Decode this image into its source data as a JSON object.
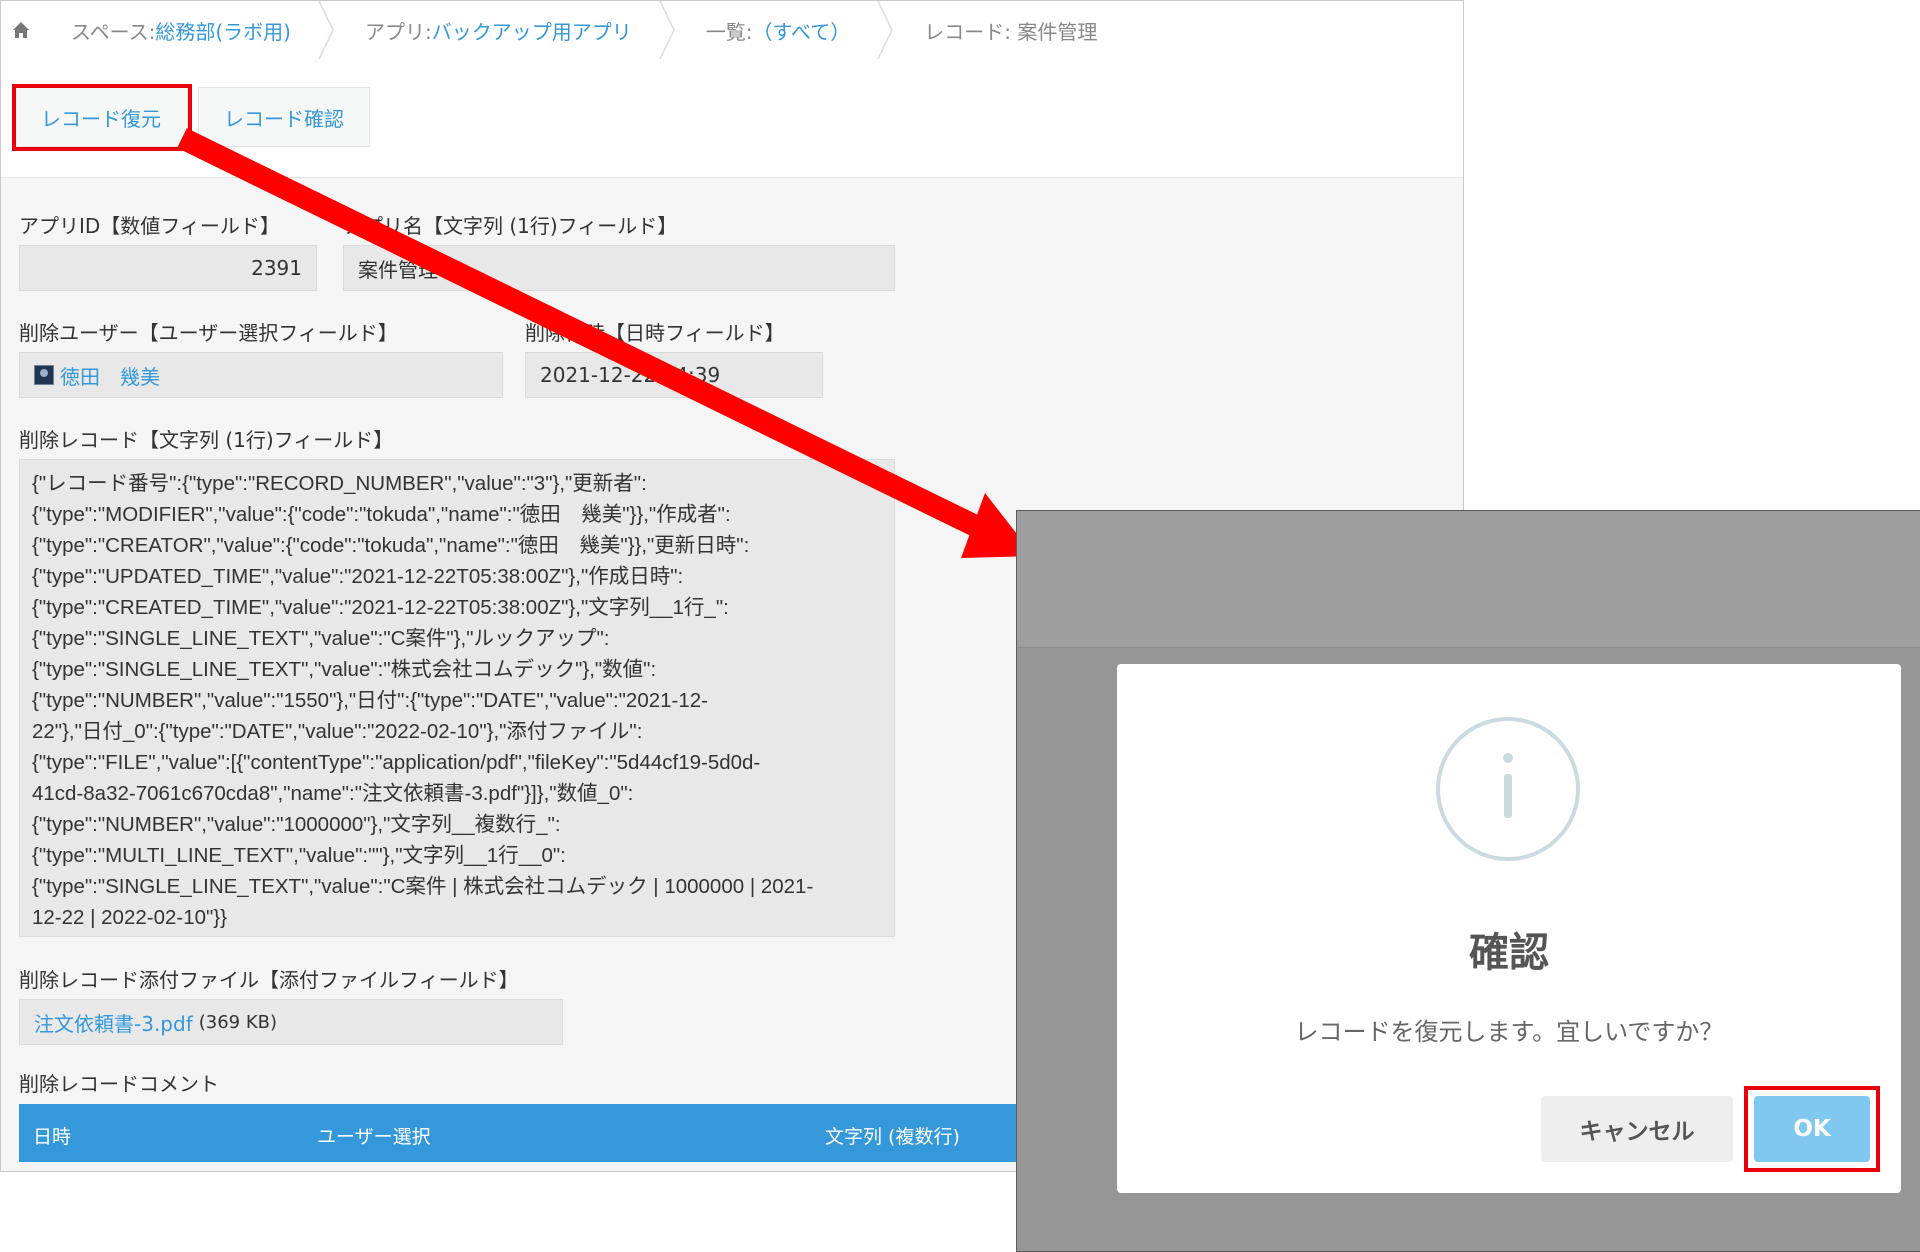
{
  "breadcrumb": {
    "space_prefix": "スペース: ",
    "space_name": "総務部(ラボ用)",
    "app_prefix": "アプリ: ",
    "app_name": "バックアップ用アプリ",
    "list_prefix": "一覧: ",
    "list_name": "（すべて）",
    "record_text": "レコード: 案件管理"
  },
  "tabs": {
    "restore_label": "レコード復元",
    "confirm_label": "レコード確認"
  },
  "form": {
    "app_id_label": "アプリID【数値フィールド】",
    "app_id_value": "2391",
    "app_name_label": "アプリ名【文字列 (1行)フィールド】",
    "app_name_value": "案件管理",
    "deleted_user_label": "削除ユーザー【ユーザー選択フィールド】",
    "deleted_user_value": "徳田　幾美",
    "deleted_at_label": "削除日時【日時フィールド】",
    "deleted_at_value": "2021-12-22 14:39",
    "deleted_record_label": "削除レコード【文字列 (1行)フィールド】",
    "deleted_record_lines": [
      "{\"レコード番号\":{\"type\":\"RECORD_NUMBER\",\"value\":\"3\"},\"更新者\":",
      "{\"type\":\"MODIFIER\",\"value\":{\"code\":\"tokuda\",\"name\":\"徳田　幾美\"}},\"作成者\":",
      "{\"type\":\"CREATOR\",\"value\":{\"code\":\"tokuda\",\"name\":\"徳田　幾美\"}},\"更新日時\":",
      "{\"type\":\"UPDATED_TIME\",\"value\":\"2021-12-22T05:38:00Z\"},\"作成日時\":",
      "{\"type\":\"CREATED_TIME\",\"value\":\"2021-12-22T05:38:00Z\"},\"文字列__1行_\":",
      "{\"type\":\"SINGLE_LINE_TEXT\",\"value\":\"C案件\"},\"ルックアップ\":",
      "{\"type\":\"SINGLE_LINE_TEXT\",\"value\":\"株式会社コムデック\"},\"数値\":",
      "{\"type\":\"NUMBER\",\"value\":\"1550\"},\"日付\":{\"type\":\"DATE\",\"value\":\"2021-12-",
      "22\"},\"日付_0\":{\"type\":\"DATE\",\"value\":\"2022-02-10\"},\"添付ファイル\":",
      "{\"type\":\"FILE\",\"value\":[{\"contentType\":\"application/pdf\",\"fileKey\":\"5d44cf19-5d0d-",
      "41cd-8a32-7061c670cda8\",\"name\":\"注文依頼書-3.pdf\"}]},\"数値_0\":",
      "{\"type\":\"NUMBER\",\"value\":\"1000000\"},\"文字列__複数行_\":",
      "{\"type\":\"MULTI_LINE_TEXT\",\"value\":\"\"},\"文字列__1行__0\":",
      "{\"type\":\"SINGLE_LINE_TEXT\",\"value\":\"C案件 | 株式会社コムデック | 1000000 | 2021-",
      "12-22 | 2022-02-10\"}}"
    ],
    "attachment_label": "削除レコード添付ファイル【添付ファイルフィールド】",
    "attachment_name": "注文依頼書-3.pdf",
    "attachment_size": "(369 KB)",
    "comment_label": "削除レコードコメント",
    "comment_columns": [
      "日時",
      "ユーザー選択",
      "文字列 (複数行)"
    ]
  },
  "dialog": {
    "icon": "info-circle-icon",
    "title": "確認",
    "message": "レコードを復元します。宜しいですか？",
    "cancel_label": "キャンセル",
    "ok_label": "OK"
  },
  "colors": {
    "accent": "#3498db",
    "highlight": "#e8000b",
    "ok_button": "#7fc9f0"
  }
}
